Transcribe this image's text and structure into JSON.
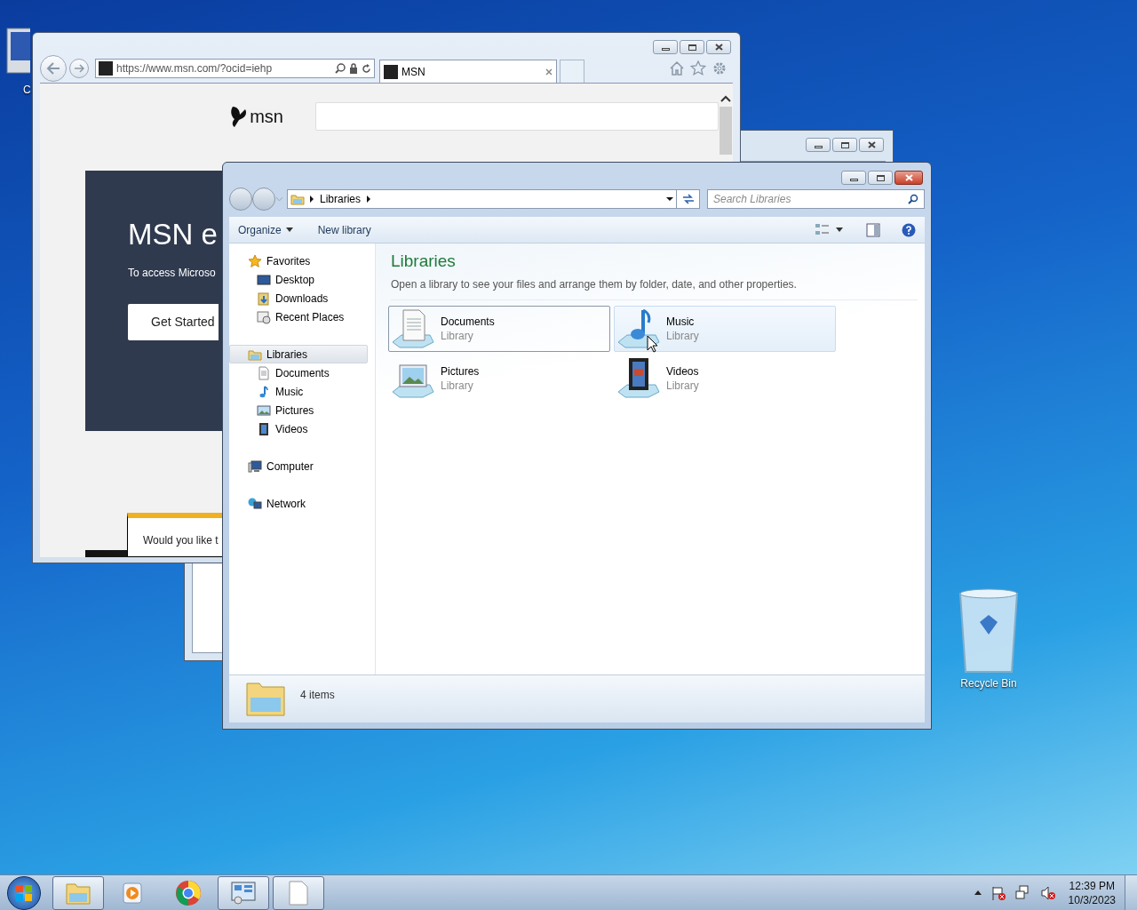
{
  "desktop": {
    "icons": [
      {
        "kind": "computer",
        "label": "C"
      },
      {
        "kind": "recycle-bin",
        "label": "Recycle Bin"
      }
    ]
  },
  "browser": {
    "url": "https://www.msn.com/?ocid=iehp",
    "tab": {
      "title": "MSN"
    },
    "page": {
      "logo": "msn",
      "headline": "MSN e",
      "subtext": "To access Microso",
      "button": "Get Started",
      "banner": "Would you like t"
    }
  },
  "explorer": {
    "breadcrumb": [
      "Libraries"
    ],
    "search": {
      "placeholder": "Search Libraries"
    },
    "toolbar": [
      {
        "label": "Organize",
        "dropdown": true
      },
      {
        "label": "New library",
        "dropdown": false
      }
    ],
    "nav": [
      {
        "label": "Favorites",
        "kind": "star",
        "selected": false,
        "children": [
          {
            "label": "Desktop",
            "kind": "desktop",
            "selected": false
          },
          {
            "label": "Downloads",
            "kind": "downloads",
            "selected": false
          },
          {
            "label": "Recent Places",
            "kind": "recent",
            "selected": false
          }
        ]
      },
      {
        "label": "Libraries",
        "kind": "library",
        "selected": true,
        "children": [
          {
            "label": "Documents",
            "kind": "documents",
            "selected": false
          },
          {
            "label": "Music",
            "kind": "music",
            "selected": false
          },
          {
            "label": "Pictures",
            "kind": "pictures",
            "selected": false
          },
          {
            "label": "Videos",
            "kind": "videos",
            "selected": false
          }
        ]
      },
      {
        "label": "Computer",
        "kind": "computer",
        "selected": false
      },
      {
        "label": "Network",
        "kind": "network",
        "selected": false
      }
    ],
    "heading": "Libraries",
    "description": "Open a library to see your files and arrange them by folder, date, and other properties.",
    "libraries": [
      {
        "name": "Documents",
        "type": "Library",
        "kind": "documents",
        "selected": true,
        "hovered": false
      },
      {
        "name": "Music",
        "type": "Library",
        "kind": "music",
        "selected": false,
        "hovered": true
      },
      {
        "name": "Pictures",
        "type": "Library",
        "kind": "pictures",
        "selected": false,
        "hovered": false
      },
      {
        "name": "Videos",
        "type": "Library",
        "kind": "videos",
        "selected": false,
        "hovered": false
      }
    ],
    "status": "4 items"
  },
  "taskbar": {
    "items": [
      {
        "kind": "explorer",
        "running": true
      },
      {
        "kind": "media-player",
        "running": false
      },
      {
        "kind": "chrome",
        "running": false
      },
      {
        "kind": "control-panel",
        "running": true
      },
      {
        "kind": "document",
        "running": true
      }
    ],
    "clock": {
      "time": "12:39 PM",
      "date": "10/3/2023"
    }
  }
}
